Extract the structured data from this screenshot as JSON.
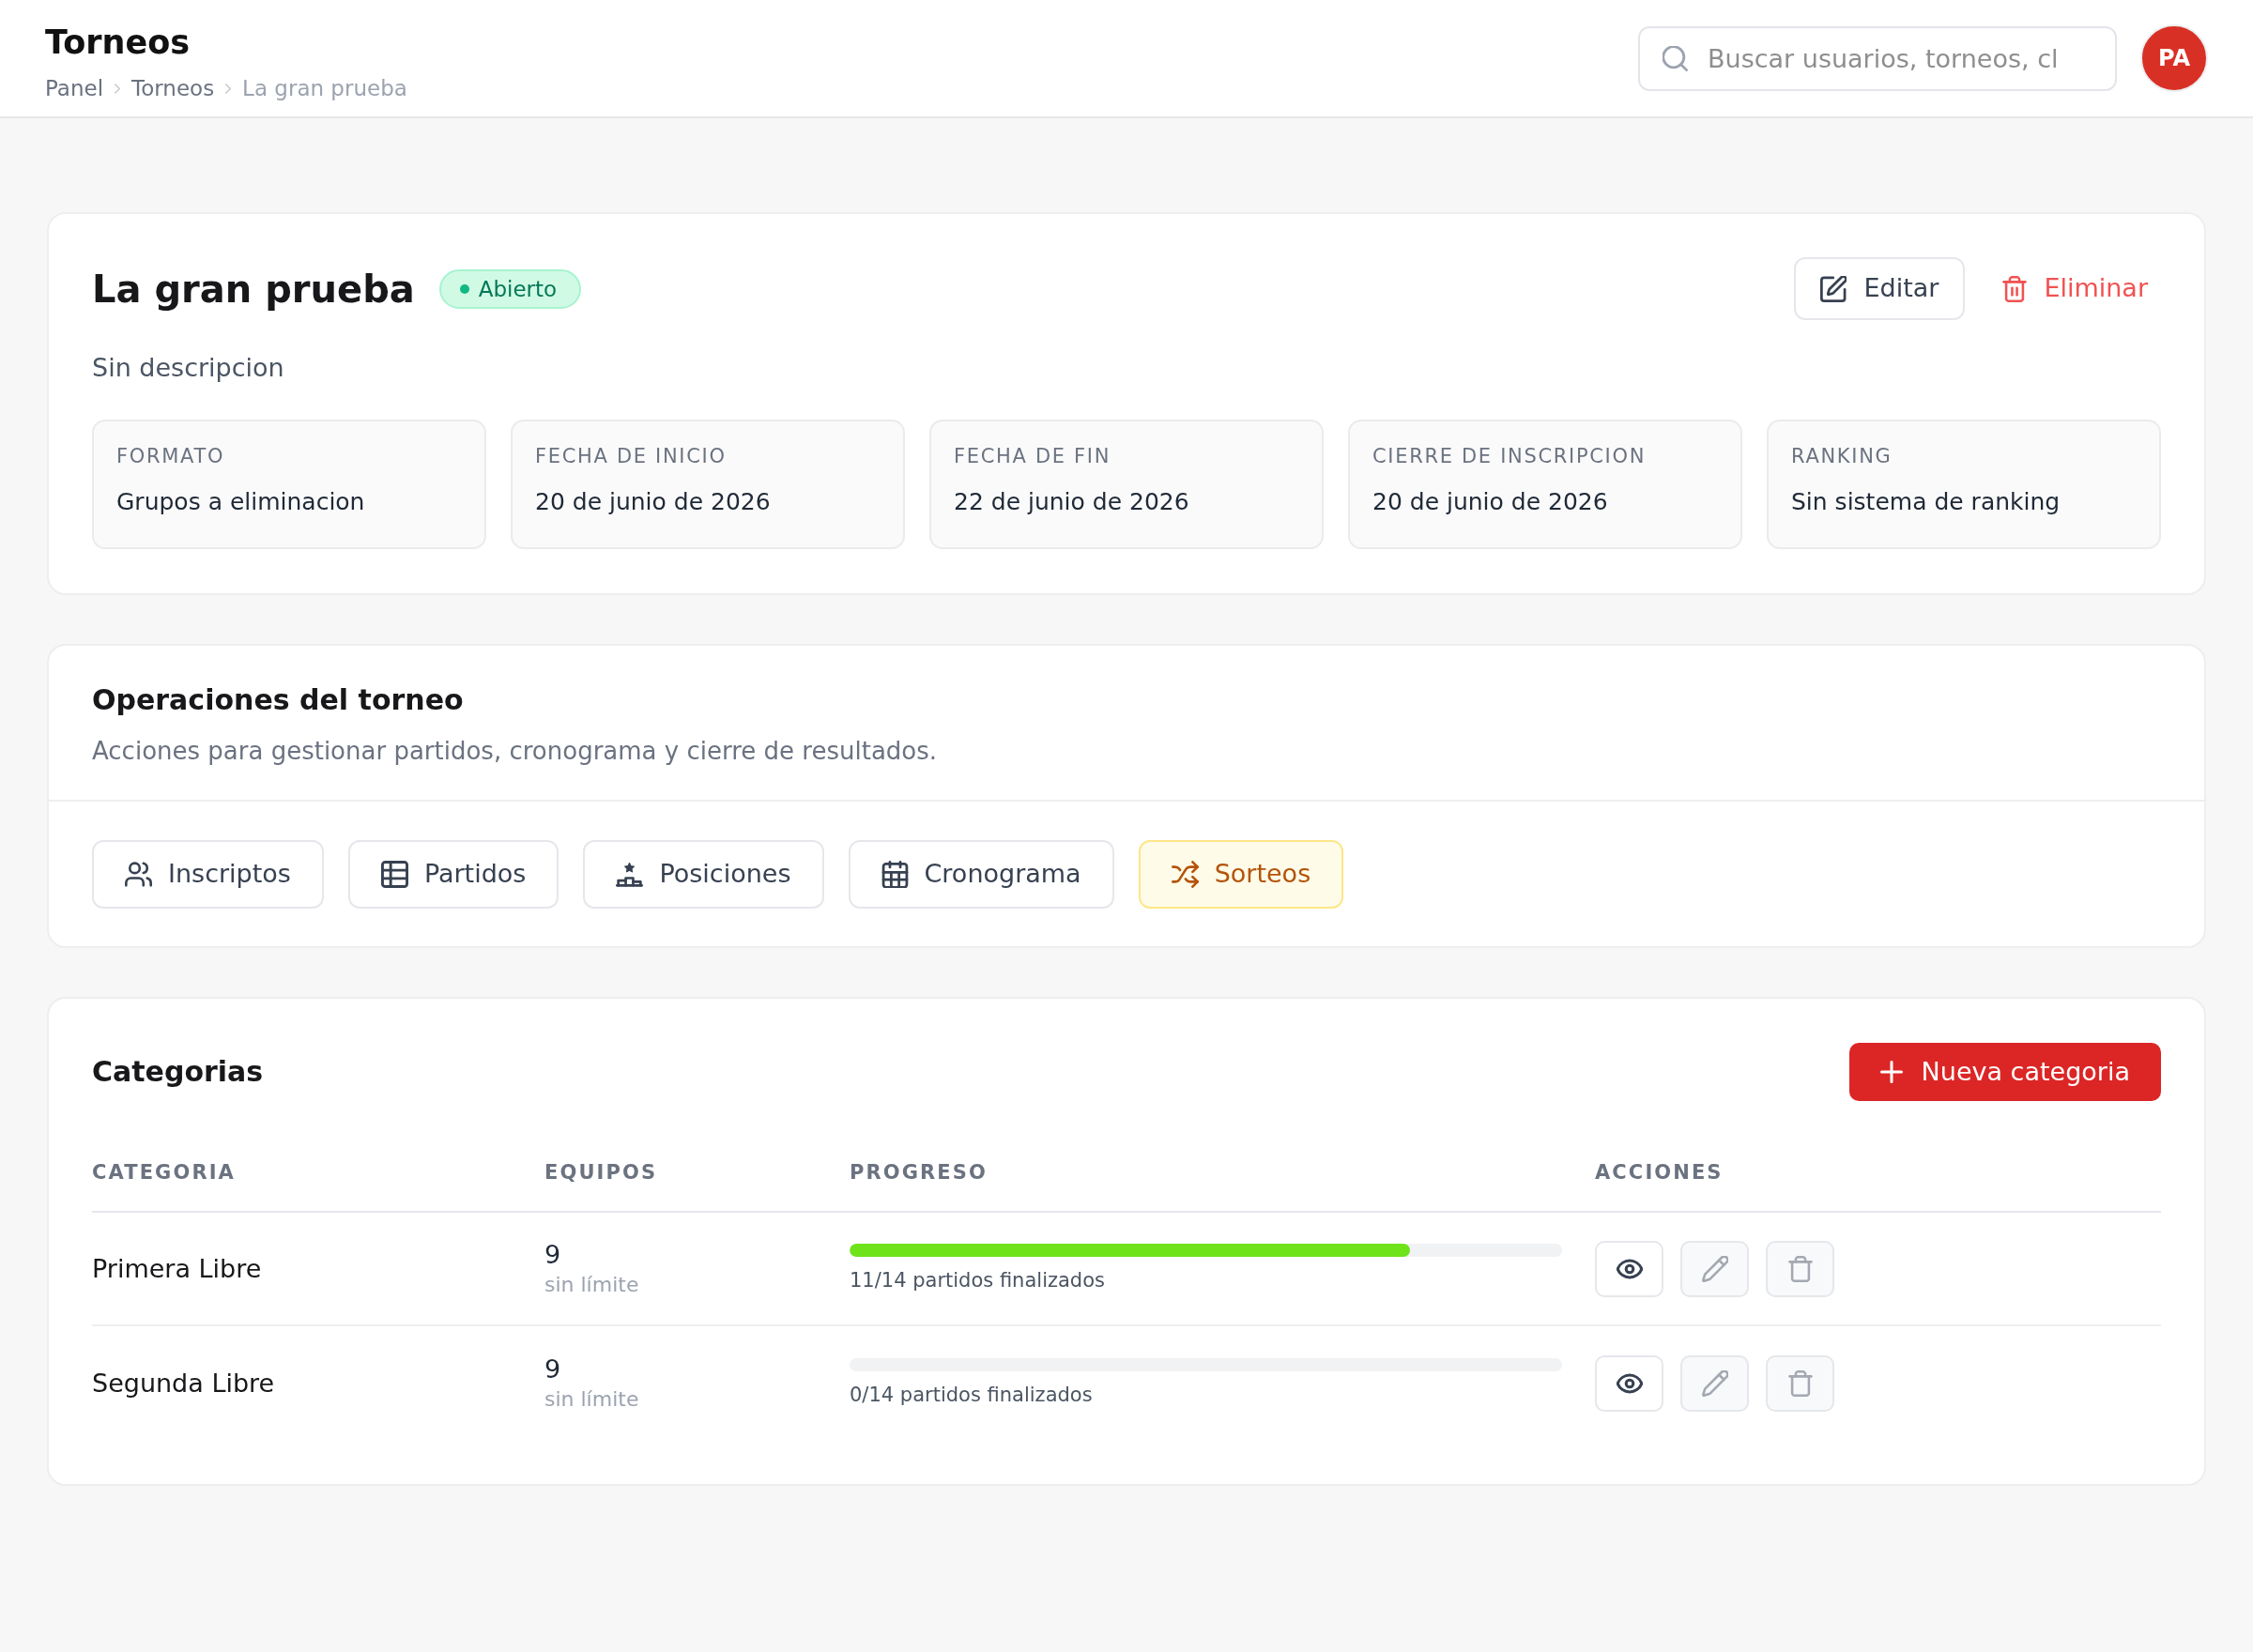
{
  "header": {
    "title": "Torneos",
    "breadcrumb": [
      {
        "label": "Panel",
        "current": false
      },
      {
        "label": "Torneos",
        "current": false
      },
      {
        "label": "La gran prueba",
        "current": true
      }
    ],
    "search": {
      "placeholder": "Buscar usuarios, torneos, cl"
    },
    "avatar": {
      "initials": "PA"
    }
  },
  "tournament": {
    "title": "La gran prueba",
    "status": {
      "label": "Abierto",
      "kind": "open"
    },
    "actions": [
      {
        "label": "Editar",
        "kind": "edit"
      },
      {
        "label": "Eliminar",
        "kind": "delete"
      }
    ],
    "description": "Sin descripcion",
    "details": [
      {
        "label": "FORMATO",
        "value": "Grupos a eliminacion"
      },
      {
        "label": "FECHA DE INICIO",
        "value": "20 de junio de 2026"
      },
      {
        "label": "FECHA DE FIN",
        "value": "22 de junio de 2026"
      },
      {
        "label": "CIERRE DE INSCRIPCION",
        "value": "20 de junio de 2026"
      },
      {
        "label": "RANKING",
        "value": "Sin sistema de ranking"
      }
    ]
  },
  "operations": {
    "title": "Operaciones del torneo",
    "subtitle": "Acciones para gestionar partidos, cronograma y cierre de resultados.",
    "buttons": [
      {
        "label": "Inscriptos",
        "kind": "registrations",
        "highlighted": false
      },
      {
        "label": "Partidos",
        "kind": "matches",
        "highlighted": false
      },
      {
        "label": "Posiciones",
        "kind": "standings",
        "highlighted": false
      },
      {
        "label": "Cronograma",
        "kind": "schedule",
        "highlighted": false
      },
      {
        "label": "Sorteos",
        "kind": "draws",
        "highlighted": true
      }
    ]
  },
  "categories": {
    "title": "Categorias",
    "new_button": {
      "label": "Nueva categoria"
    },
    "columns": [
      "CATEGORIA",
      "EQUIPOS",
      "PROGRESO",
      "ACCIONES"
    ],
    "rows": [
      {
        "name": "Primera Libre",
        "teams": "9",
        "team_limit": "sin límite",
        "progress": {
          "level": 0.786,
          "label": "11/14 partidos finalizados"
        },
        "actions": [
          {
            "kind": "view",
            "disabled": false
          },
          {
            "kind": "edit",
            "disabled": true
          },
          {
            "kind": "delete",
            "disabled": true
          }
        ]
      },
      {
        "name": "Segunda Libre",
        "teams": "9",
        "team_limit": "sin límite",
        "progress": {
          "level": 0,
          "label": "0/14 partidos finalizados"
        },
        "actions": [
          {
            "kind": "view",
            "disabled": false
          },
          {
            "kind": "edit",
            "disabled": true
          },
          {
            "kind": "delete",
            "disabled": true
          }
        ]
      }
    ]
  }
}
